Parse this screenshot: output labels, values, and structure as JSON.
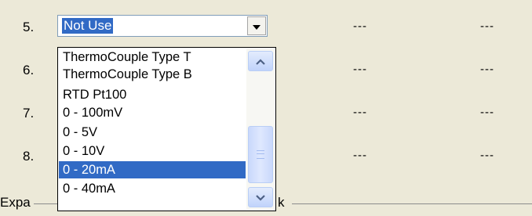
{
  "rows": [
    {
      "num": "5.",
      "col_a": "---",
      "col_b": "---"
    },
    {
      "num": "6.",
      "col_a": "---",
      "col_b": "---"
    },
    {
      "num": "7.",
      "col_a": "---",
      "col_b": "---"
    },
    {
      "num": "8.",
      "col_a": "---",
      "col_b": "---"
    }
  ],
  "combo": {
    "value": "Not Use",
    "arrow_icon": "chevron-down-icon"
  },
  "dropdown": {
    "options": [
      "ThermoCouple Type T",
      "ThermoCouple Type B",
      "RTD Pt100",
      "0 - 100mV",
      "0 - 5V",
      "0 - 10V",
      "0 - 20mA",
      "0 - 40mA"
    ],
    "selected_option": "0 - 20mA",
    "scroll_up_icon": "chevron-up-icon",
    "scroll_down_icon": "chevron-down-icon"
  },
  "group_box": {
    "label_left": "Expa",
    "label_right": "k"
  },
  "colors": {
    "window_bg": "#ece9d8",
    "selection": "#316ac5",
    "scrollbar_accent": "#4d6185"
  }
}
